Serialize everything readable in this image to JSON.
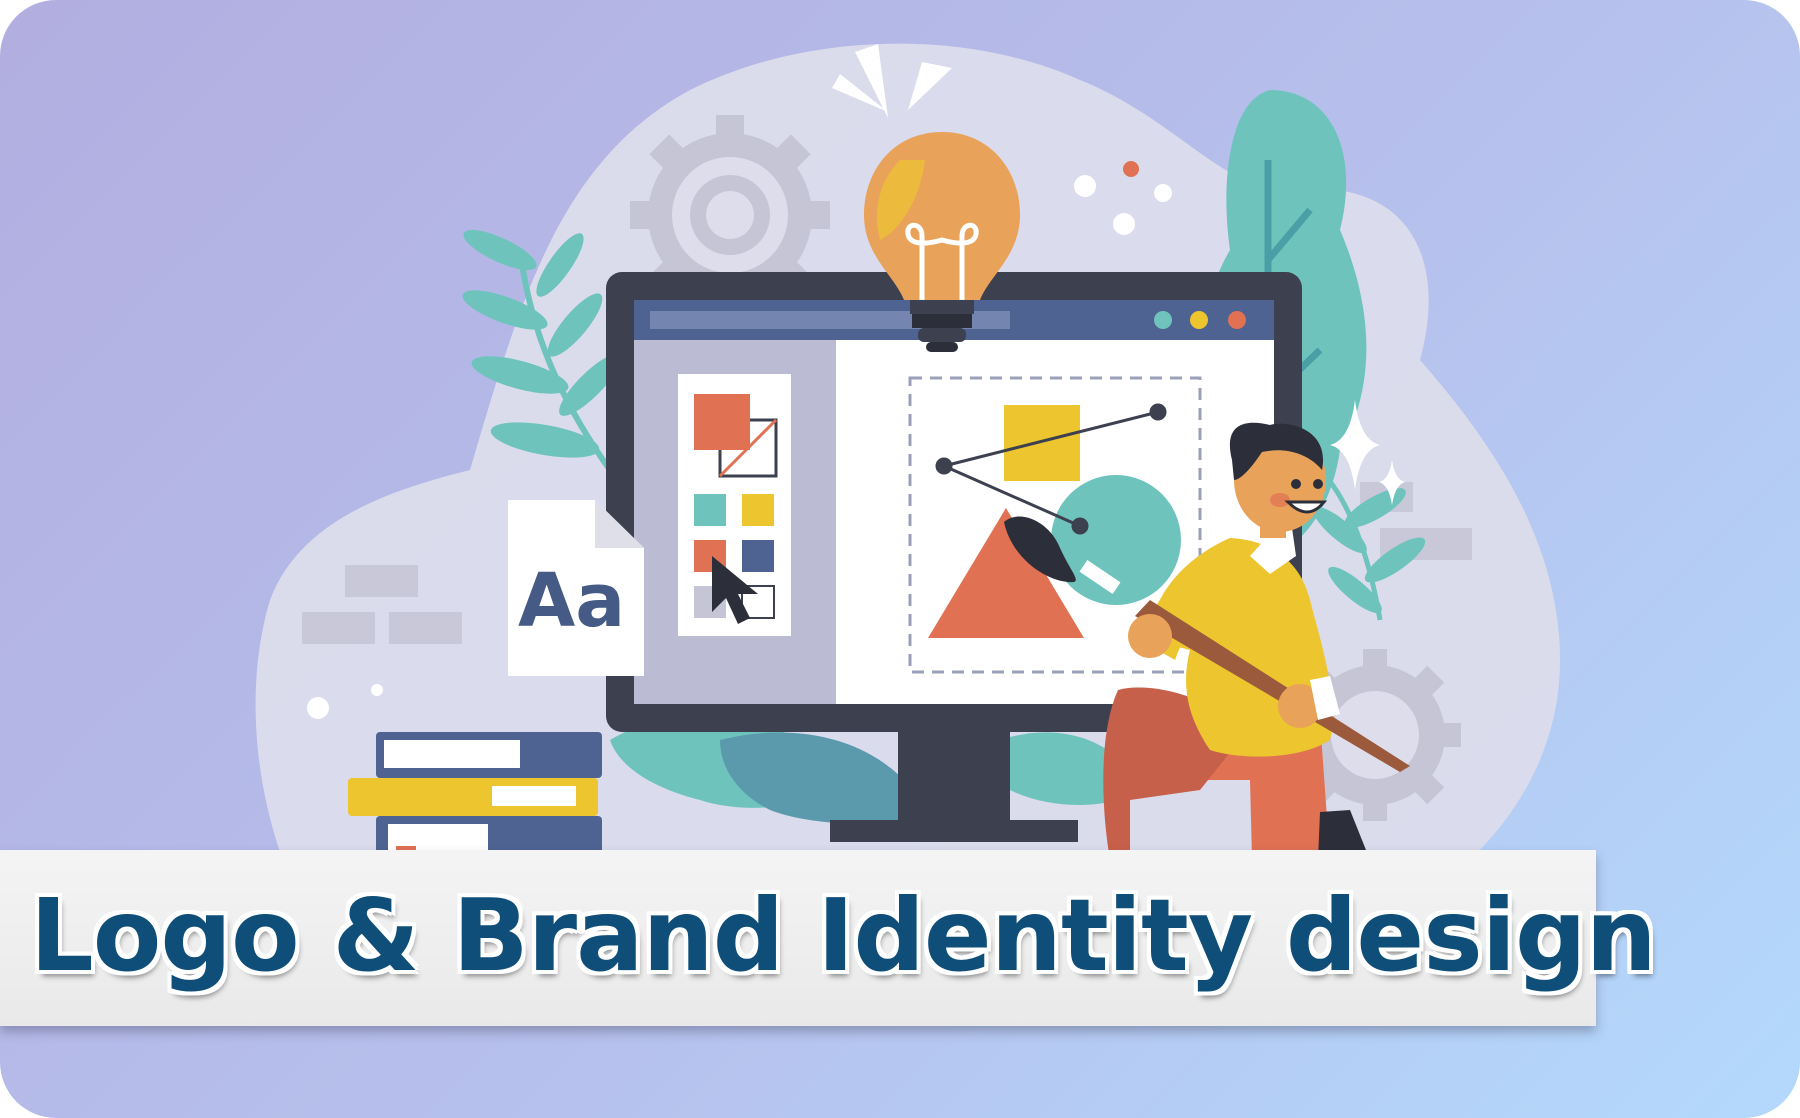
{
  "banner": {
    "title": "Logo & Brand Identity design"
  },
  "type_card": {
    "text": "Aa"
  },
  "colors": {
    "background_start": "#b2aee0",
    "background_end": "#b3d9fc",
    "banner_text": "#0e4e79",
    "banner_bg": "#f0f0f0",
    "accent_orange": "#e07153",
    "accent_yellow": "#ecc52f",
    "accent_teal": "#6ec4bd",
    "accent_navy": "#4e6391"
  },
  "icons": [
    "gear-icon",
    "light-bulb-icon",
    "monitor-icon",
    "window-control-dots-icon",
    "color-swatch-icon",
    "cursor-arrow-icon",
    "font-document-icon",
    "paint-brush-icon",
    "bezier-path-icon",
    "book-stack-icon",
    "leaf-icon",
    "sparkle-icon"
  ]
}
